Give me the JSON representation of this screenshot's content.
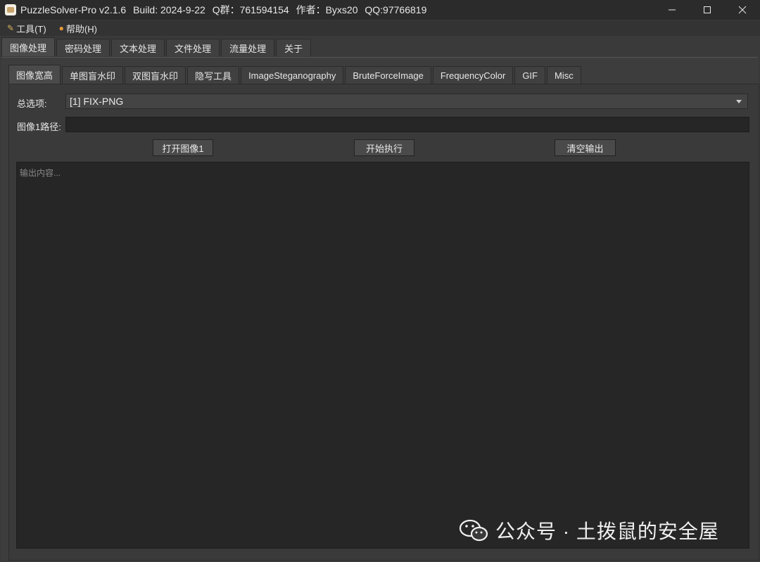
{
  "window": {
    "title_parts": [
      "PuzzleSolver-Pro v2.1.6",
      "Build: 2024-9-22",
      "Q群：761594154",
      "作者：Byxs20",
      "QQ:97766819"
    ]
  },
  "menu": [
    {
      "label": "工具(T)",
      "icon": "tools-icon"
    },
    {
      "label": "帮助(H)",
      "icon": "help-icon"
    }
  ],
  "main_tabs": [
    "图像处理",
    "密码处理",
    "文本处理",
    "文件处理",
    "流量处理",
    "关于"
  ],
  "main_tab_active": 0,
  "sub_tabs": [
    "图像宽高",
    "单图盲水印",
    "双图盲水印",
    "隐写工具",
    "ImageSteganography",
    "BruteForceImage",
    "FrequencyColor",
    "GIF",
    "Misc"
  ],
  "sub_tab_active": 0,
  "form": {
    "option_label": "总选项:",
    "option_value": "[1] FIX-PNG",
    "path_label": "图像1路径:",
    "path_value": ""
  },
  "buttons": {
    "open": "打开图像1",
    "run": "开始执行",
    "clear": "清空输出"
  },
  "output": {
    "placeholder": "输出内容..."
  },
  "watermark": {
    "text": "公众号 · 土拨鼠的安全屋"
  }
}
